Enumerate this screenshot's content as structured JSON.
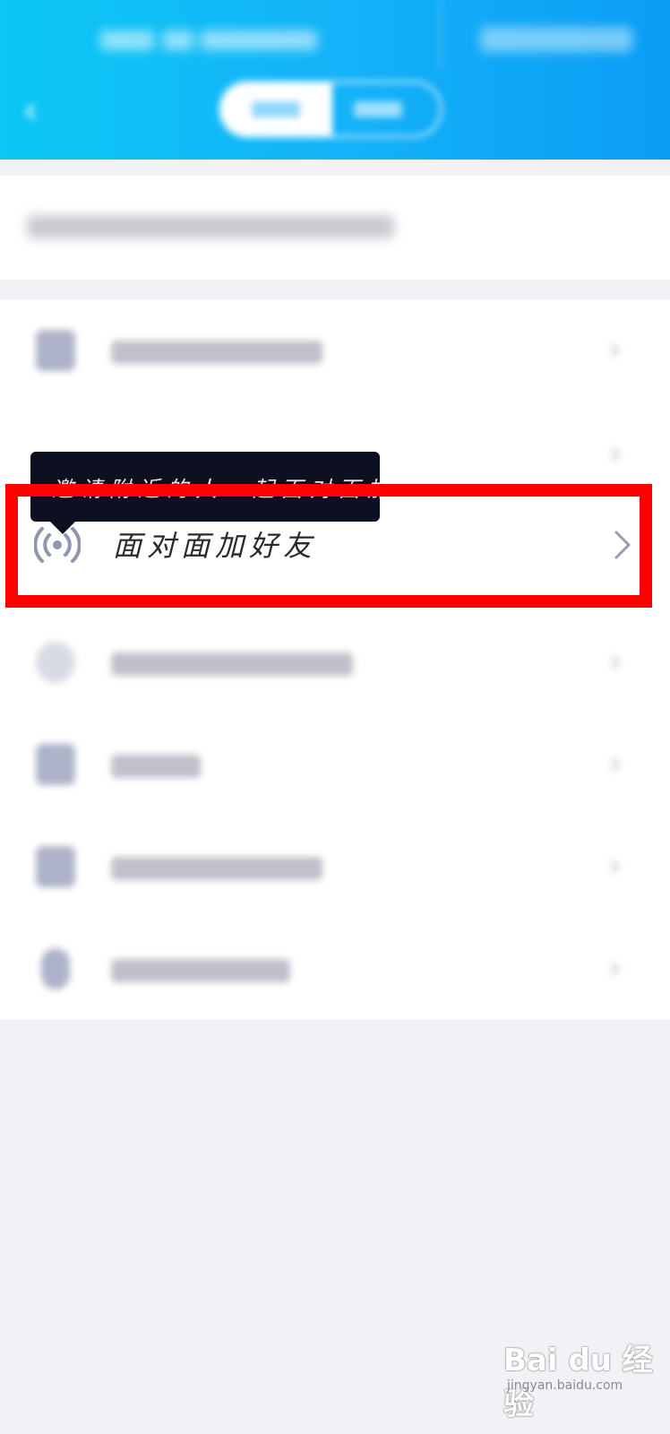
{
  "header": {
    "back_icon": "chevron-left-icon",
    "segment_tabs": [
      "",
      ""
    ],
    "active_tab_index": 0
  },
  "search": {
    "placeholder": ""
  },
  "list": {
    "highlighted_item": {
      "label": "面对面加好友",
      "icon": "radio-waves-icon",
      "tooltip": "邀请附近的人一起面对面加好友吧"
    },
    "chevron_icon": "chevron-right-icon"
  },
  "watermark": {
    "logo_text": "Bai du 经验",
    "url": "jingyan.baidu.com"
  },
  "colors": {
    "header_start": "#0bc8f5",
    "header_end": "#0a9df5",
    "highlight_frame": "#ff0000",
    "tooltip_bg": "#0c1020"
  }
}
